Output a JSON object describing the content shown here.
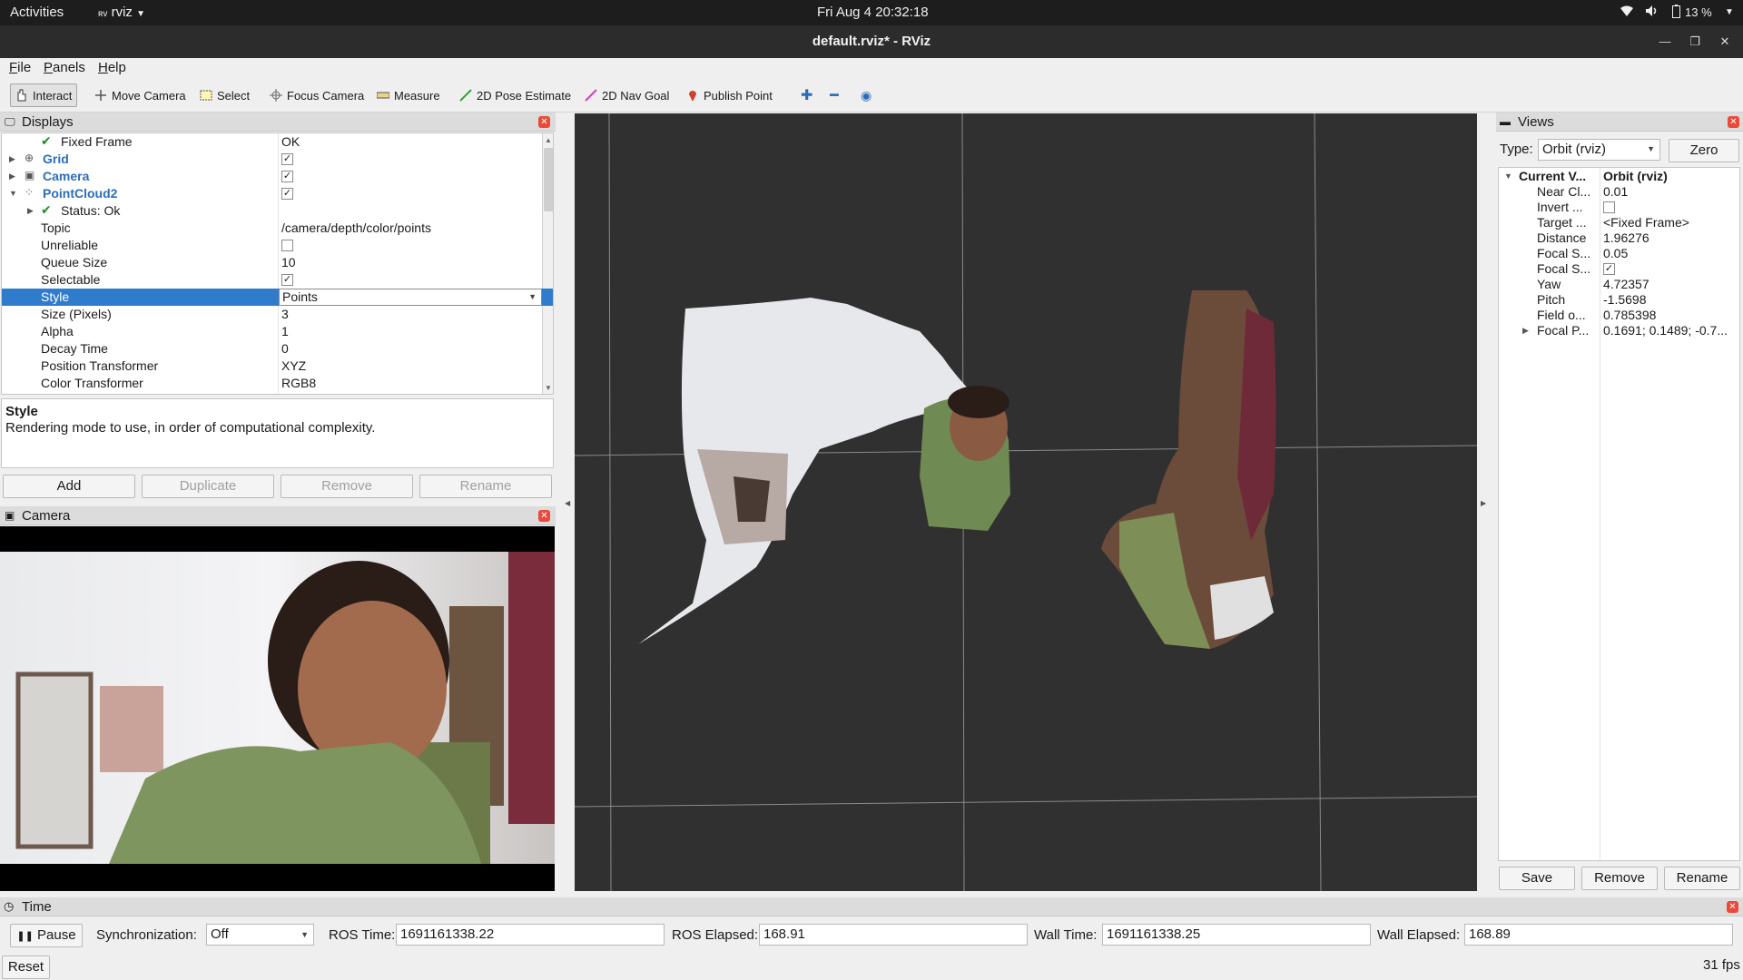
{
  "topbar": {
    "activities": "Activities",
    "app_name": "rviz",
    "clock": "Fri Aug 4  20:32:18",
    "battery": "13 %"
  },
  "window": {
    "title": "default.rviz* - RViz"
  },
  "menu": {
    "items": [
      "File",
      "Panels",
      "Help"
    ]
  },
  "toolbar": {
    "tools": [
      "Interact",
      "Move Camera",
      "Select",
      "Focus Camera",
      "Measure",
      "2D Pose Estimate",
      "2D Nav Goal",
      "Publish Point"
    ],
    "active": "Interact"
  },
  "displays": {
    "title": "Displays",
    "rows": [
      {
        "key": "Fixed Frame",
        "value": "OK"
      },
      {
        "key": "Grid",
        "value": ""
      },
      {
        "key": "Camera",
        "value": ""
      },
      {
        "key": "PointCloud2",
        "value": ""
      },
      {
        "key": "Status: Ok",
        "value": ""
      },
      {
        "key": "Topic",
        "value": "/camera/depth/color/points"
      },
      {
        "key": "Unreliable",
        "value": ""
      },
      {
        "key": "Queue Size",
        "value": "10"
      },
      {
        "key": "Selectable",
        "value": ""
      },
      {
        "key": "Style",
        "value": "Points"
      },
      {
        "key": "Size (Pixels)",
        "value": "3"
      },
      {
        "key": "Alpha",
        "value": "1"
      },
      {
        "key": "Decay Time",
        "value": "0"
      },
      {
        "key": "Position Transformer",
        "value": "XYZ"
      },
      {
        "key": "Color Transformer",
        "value": "RGB8"
      }
    ],
    "desc_title": "Style",
    "desc_text": "Rendering mode to use, in order of computational complexity.",
    "buttons": [
      "Add",
      "Duplicate",
      "Remove",
      "Rename"
    ]
  },
  "camera_panel": {
    "title": "Camera"
  },
  "views": {
    "title": "Views",
    "type_label": "Type:",
    "type_value": "Orbit (rviz)",
    "zero": "Zero",
    "rows": [
      {
        "key": "Current V...",
        "value": "Orbit (rviz)"
      },
      {
        "key": "Near Cl...",
        "value": "0.01"
      },
      {
        "key": "Invert ...",
        "value": ""
      },
      {
        "key": "Target ...",
        "value": "<Fixed Frame>"
      },
      {
        "key": "Distance",
        "value": "1.96276"
      },
      {
        "key": "Focal S...",
        "value": "0.05"
      },
      {
        "key": "Focal S...",
        "value": ""
      },
      {
        "key": "Yaw",
        "value": "4.72357"
      },
      {
        "key": "Pitch",
        "value": "-1.5698"
      },
      {
        "key": "Field o...",
        "value": "0.785398"
      },
      {
        "key": "Focal P...",
        "value": "0.1691; 0.1489; -0.7..."
      }
    ],
    "buttons": [
      "Save",
      "Remove",
      "Rename"
    ]
  },
  "time": {
    "title": "Time",
    "pause": "Pause",
    "sync_label": "Synchronization:",
    "sync_value": "Off",
    "ros_time_label": "ROS Time:",
    "ros_time": "1691161338.22",
    "ros_elapsed_label": "ROS Elapsed:",
    "ros_elapsed": "168.91",
    "wall_time_label": "Wall Time:",
    "wall_time": "1691161338.25",
    "wall_elapsed_label": "Wall Elapsed:",
    "wall_elapsed": "168.89",
    "reset": "Reset",
    "fps": "31 fps"
  },
  "colors": {
    "selection": "#2f7ccc",
    "viewport_bg": "#303030",
    "close": "#ea4a3a"
  }
}
